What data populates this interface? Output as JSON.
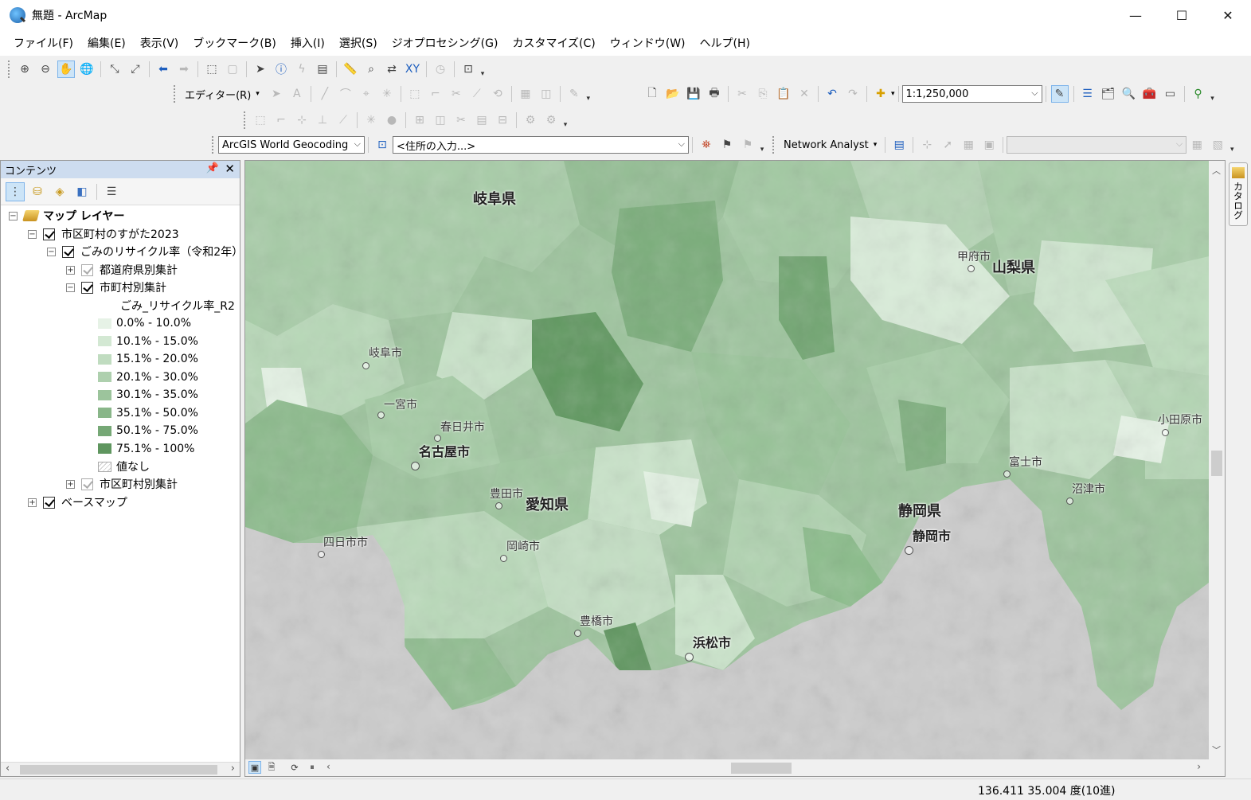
{
  "window": {
    "title": "無題 - ArcMap",
    "minimize": "—",
    "maximize": "☐",
    "close": "✕"
  },
  "menu": [
    "ファイル(F)",
    "編集(E)",
    "表示(V)",
    "ブックマーク(B)",
    "挿入(I)",
    "選択(S)",
    "ジオプロセシング(G)",
    "カスタマイズ(C)",
    "ウィンドウ(W)",
    "ヘルプ(H)"
  ],
  "toolbar": {
    "editor_label": "エディター(R)",
    "scale_value": "1:1,250,000",
    "geocoder_value": "ArcGIS World Geocoding",
    "address_placeholder": "<住所の入力...>",
    "network_analyst_label": "Network Analyst"
  },
  "toc": {
    "title": "コンテンツ",
    "root_label": "マップ レイヤー",
    "group_label": "市区町村のすがた2023",
    "subgroup_label": "ごみのリサイクル率（令和2年）",
    "pref_layer_label": "都道府県別集計",
    "muni_layer_label": "市町村別集計",
    "field_label": "ごみ_リサイクル率_R2",
    "legend": [
      {
        "label": "0.0% - 10.0%",
        "color": "#e6f2e6"
      },
      {
        "label": "10.1% - 15.0%",
        "color": "#d3e8d3"
      },
      {
        "label": "15.1% - 20.0%",
        "color": "#c0dcc0"
      },
      {
        "label": "20.1% - 30.0%",
        "color": "#aed0ae"
      },
      {
        "label": "30.1% - 35.0%",
        "color": "#9cc49c"
      },
      {
        "label": "35.1% - 50.0%",
        "color": "#89b689"
      },
      {
        "label": "50.1% - 75.0%",
        "color": "#76a876"
      },
      {
        "label": "75.1% - 100%",
        "color": "#5f965f"
      }
    ],
    "nodata_label": "値なし",
    "muni_layer2_label": "市区町村別集計",
    "basemap_label": "ベースマップ"
  },
  "map": {
    "labels": {
      "gifu_pref": "岐阜県",
      "yamanashi_pref": "山梨県",
      "aichi_pref": "愛知県",
      "shizuoka_pref": "静岡県",
      "nagoya": "名古屋市",
      "shizuoka_city": "静岡市",
      "hamamatsu": "浜松市",
      "kofu": "甲府市",
      "gifu_city": "岐阜市",
      "ichinomiya": "一宮市",
      "kasugai": "春日井市",
      "toyota": "豊田市",
      "okazaki": "岡崎市",
      "toyohashi": "豊橋市",
      "yokkaichi": "四日市市",
      "fuji": "富士市",
      "numazu": "沼津市",
      "odawara": "小田原市"
    }
  },
  "catalog_tab": "カタログ",
  "status": {
    "coords": "136.411  35.004 度(10進)"
  }
}
